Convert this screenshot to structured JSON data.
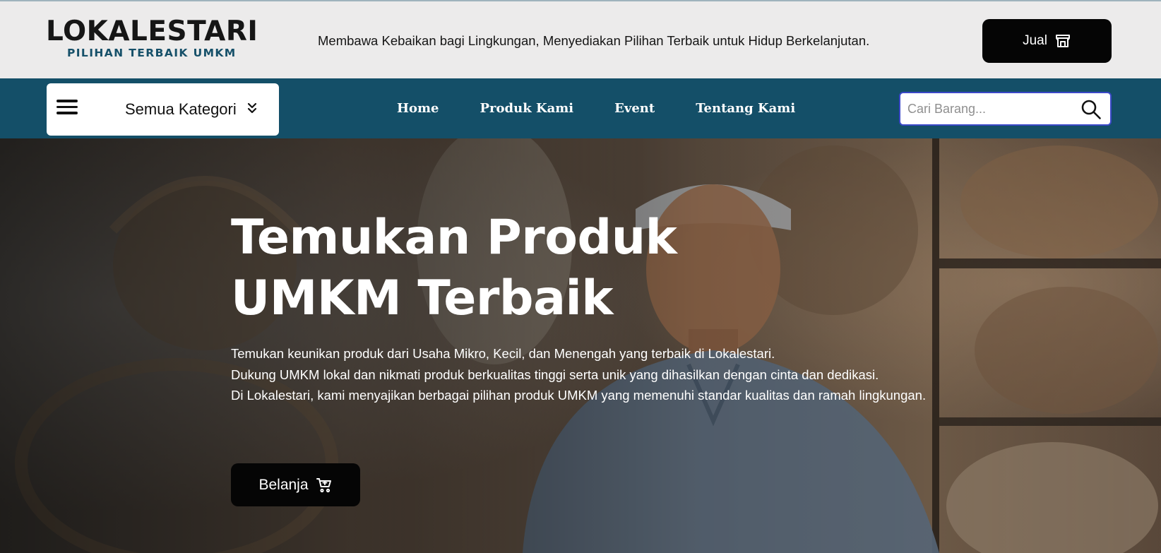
{
  "header": {
    "logo_title": "LOKALESTARI",
    "logo_subtitle": "PILIHAN TERBAIK UMKM",
    "tagline": "Membawa Kebaikan bagi Lingkungan, Menyediakan Pilihan Terbaik untuk Hidup Berkelanjutan.",
    "sell_label": "Jual",
    "sell_icon": "store-icon"
  },
  "nav": {
    "category_label": "Semua Kategori",
    "menu_icon": "hamburger-menu-icon",
    "category_chevron_icon": "double-chevron-down-icon",
    "links": [
      {
        "label": "Home"
      },
      {
        "label": "Produk Kami"
      },
      {
        "label": "Event"
      },
      {
        "label": "Tentang Kami"
      }
    ],
    "search_placeholder": "Cari Barang...",
    "search_icon": "search-icon"
  },
  "hero": {
    "title_line1": "Temukan Produk",
    "title_line2": "UMKM Terbaik",
    "paragraphs": [
      "Temukan keunikan produk dari Usaha Mikro, Kecil, dan Menengah yang terbaik di Lokalestari.",
      "Dukung UMKM lokal dan nikmati produk berkualitas tinggi serta unik yang dihasilkan dengan cinta dan dedikasi.",
      "Di Lokalestari, kami menyajikan berbagai pilihan produk UMKM yang memenuhi standar kualitas dan ramah lingkungan."
    ],
    "shop_label": "Belanja",
    "shop_icon": "shopping-cart-icon",
    "image": "smiling-craftsman-with-woven-baskets-photo"
  },
  "colors": {
    "topbar_bg": "#ecebeb",
    "navbar_bg": "#144f68",
    "brand_subtitle": "#165069",
    "button_bg": "#050505",
    "search_border": "#3b48c8"
  }
}
